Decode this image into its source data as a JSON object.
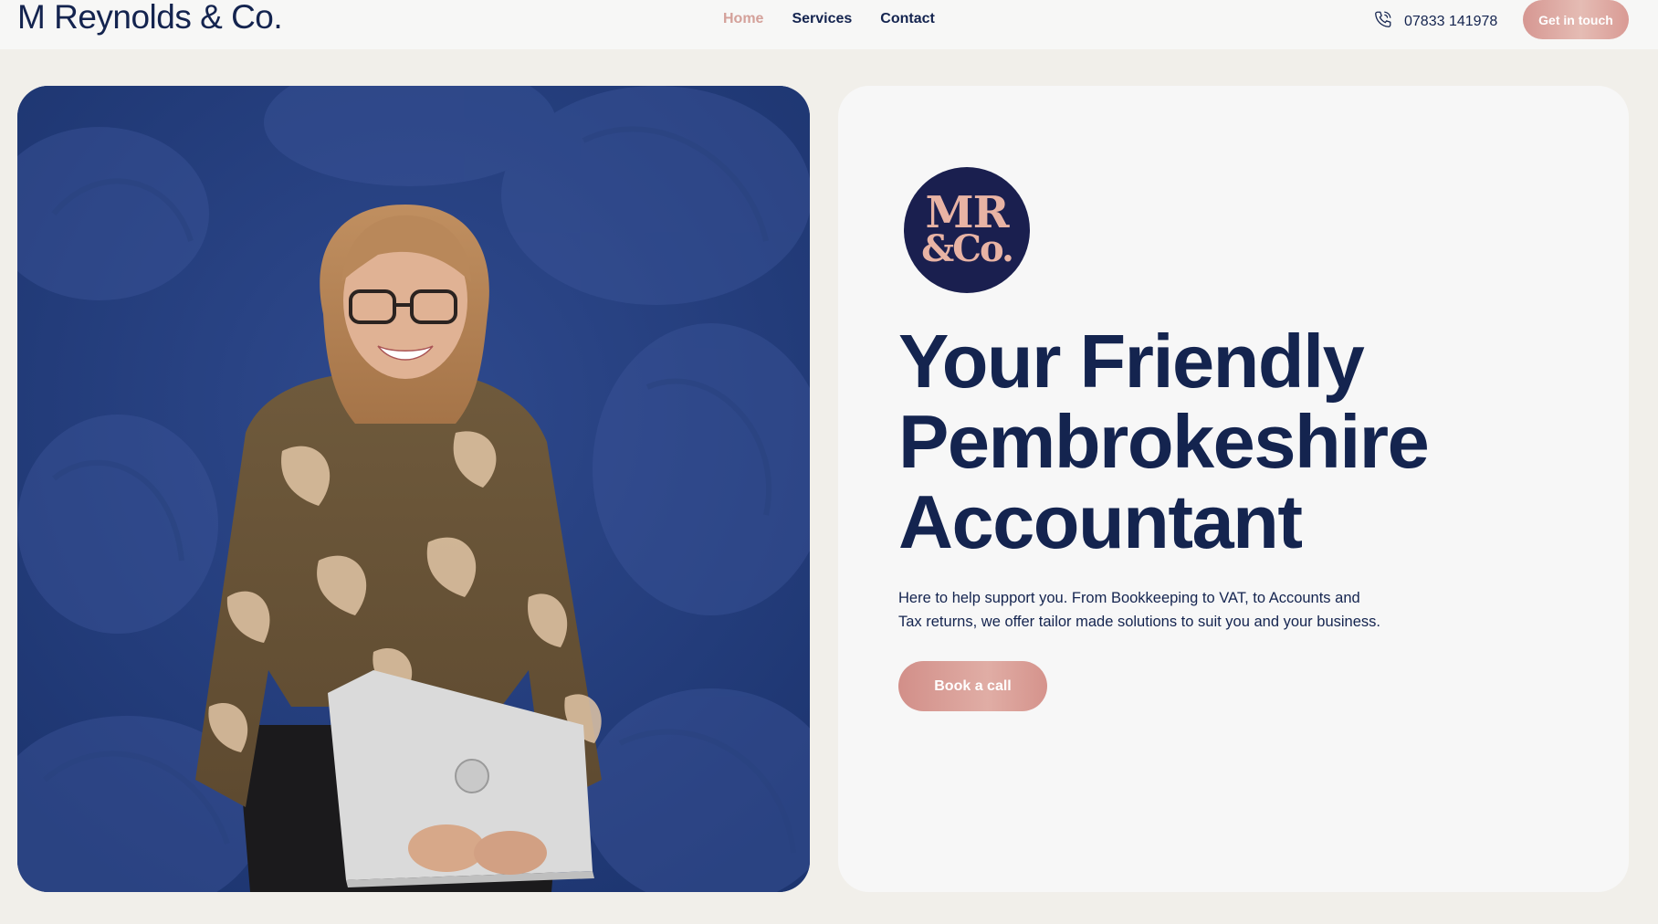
{
  "header": {
    "brand": "M Reynolds & Co.",
    "nav": [
      {
        "label": "Home",
        "active": true
      },
      {
        "label": "Services",
        "active": false
      },
      {
        "label": "Contact",
        "active": false
      }
    ],
    "phone": "07833 141978",
    "phone_icon": "phone-icon",
    "cta_label": "Get in touch"
  },
  "hero": {
    "logo": {
      "line1": "MR",
      "line2": "&Co."
    },
    "headline": [
      "Your Friendly",
      "Pembrokeshire",
      "Accountant"
    ],
    "intro_line1": "Here to help support you. From Bookkeeping to VAT, to Accounts and",
    "intro_line2": "Tax returns, we offer tailor made solutions to suit you and your business.",
    "book_label": "Book a call"
  },
  "colors": {
    "navy": "#14244f",
    "accent_pink": "#d69792",
    "page_bg": "#f1efea",
    "card_bg": "#f7f7f7",
    "photo_bg": "#223a78",
    "logo_bg": "#1a1f4f"
  }
}
